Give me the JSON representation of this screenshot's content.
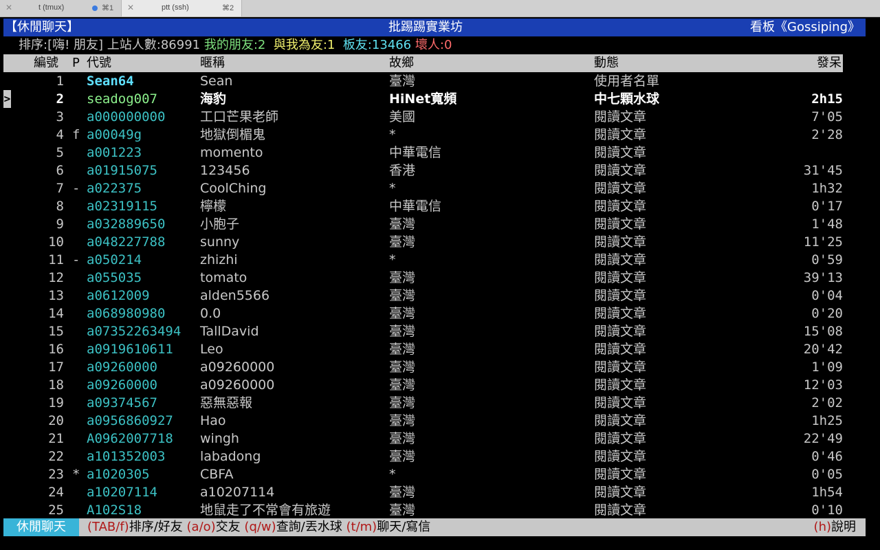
{
  "tabs": [
    {
      "title": "t (tmux)",
      "shortcut": "⌘1",
      "active": false
    },
    {
      "title": "ptt (ssh)",
      "shortcut": "⌘2",
      "active": true
    }
  ],
  "header": {
    "left": "【休閒聊天】",
    "center": "批踢踢實業坊",
    "right": "看板《Gossiping》"
  },
  "status": {
    "sort_label": "排序:[嗨! 朋友]",
    "online_label": "上站人數:86991",
    "my_friends": "我的朋友:2",
    "friend_of": "與我為友:1",
    "board_friends": "板友:13466",
    "bad_people": "壞人:0"
  },
  "columns": {
    "num": "編號",
    "p": "P",
    "id": "代號",
    "nick": "暱稱",
    "from": "故鄉",
    "act": "動態",
    "idle": "發呆"
  },
  "users": [
    {
      "num": "1",
      "p": "",
      "id": "Sean64",
      "nick": "Sean",
      "from": "臺灣",
      "act": "使用者名單",
      "idle": ""
    },
    {
      "num": "2",
      "p": "",
      "id": "seadog007",
      "nick": "海豹",
      "from": "HiNet寬頻",
      "act": "中七顆水球",
      "idle": "2h15"
    },
    {
      "num": "3",
      "p": "",
      "id": "a000000000",
      "nick": "工口芒果老師",
      "from": "美國",
      "act": "閱讀文章",
      "idle": "7'05"
    },
    {
      "num": "4",
      "p": "f",
      "id": "a00049g",
      "nick": "地獄倒楣鬼",
      "from": "*",
      "act": "閱讀文章",
      "idle": "2'28"
    },
    {
      "num": "5",
      "p": "",
      "id": "a001223",
      "nick": "momento",
      "from": "中華電信",
      "act": "閱讀文章",
      "idle": ""
    },
    {
      "num": "6",
      "p": "",
      "id": "a01915075",
      "nick": "123456",
      "from": "香港",
      "act": "閱讀文章",
      "idle": "31'45"
    },
    {
      "num": "7",
      "p": "-",
      "id": "a022375",
      "nick": "CoolChing",
      "from": "*",
      "act": "閱讀文章",
      "idle": "1h32"
    },
    {
      "num": "8",
      "p": "",
      "id": "a02319115",
      "nick": "檸檬",
      "from": "中華電信",
      "act": "閱讀文章",
      "idle": "0'17"
    },
    {
      "num": "9",
      "p": "",
      "id": "a032889650",
      "nick": "小胞子",
      "from": "臺灣",
      "act": "閱讀文章",
      "idle": "1'48"
    },
    {
      "num": "10",
      "p": "",
      "id": "a048227788",
      "nick": "sunny",
      "from": "臺灣",
      "act": "閱讀文章",
      "idle": "11'25"
    },
    {
      "num": "11",
      "p": "-",
      "id": "a050214",
      "nick": "zhizhi",
      "from": "*",
      "act": "閱讀文章",
      "idle": "0'59"
    },
    {
      "num": "12",
      "p": "",
      "id": "a055035",
      "nick": "tomato",
      "from": "臺灣",
      "act": "閱讀文章",
      "idle": "39'13"
    },
    {
      "num": "13",
      "p": "",
      "id": "a0612009",
      "nick": "alden5566",
      "from": "臺灣",
      "act": "閱讀文章",
      "idle": "0'04"
    },
    {
      "num": "14",
      "p": "",
      "id": "a068980980",
      "nick": "0.0",
      "from": "臺灣",
      "act": "閱讀文章",
      "idle": "0'20"
    },
    {
      "num": "15",
      "p": "",
      "id": "a07352263494",
      "nick": "TallDavid",
      "from": "臺灣",
      "act": "閱讀文章",
      "idle": "15'08"
    },
    {
      "num": "16",
      "p": "",
      "id": "a0919610611",
      "nick": "Leo",
      "from": "臺灣",
      "act": "閱讀文章",
      "idle": "20'42"
    },
    {
      "num": "17",
      "p": "",
      "id": "a09260000",
      "nick": "a09260000",
      "from": "臺灣",
      "act": "閱讀文章",
      "idle": "1'09"
    },
    {
      "num": "18",
      "p": "",
      "id": "a09260000",
      "nick": "a09260000",
      "from": "臺灣",
      "act": "閱讀文章",
      "idle": "12'03"
    },
    {
      "num": "19",
      "p": "",
      "id": "a09374567",
      "nick": "惡無惡報",
      "from": "臺灣",
      "act": "閱讀文章",
      "idle": "2'02"
    },
    {
      "num": "20",
      "p": "",
      "id": "a0956860927",
      "nick": "Hao",
      "from": "臺灣",
      "act": "閱讀文章",
      "idle": "1h25"
    },
    {
      "num": "21",
      "p": "",
      "id": "A0962007718",
      "nick": "wingh",
      "from": "臺灣",
      "act": "閱讀文章",
      "idle": "22'49"
    },
    {
      "num": "22",
      "p": "",
      "id": "a101352003",
      "nick": "labadong",
      "from": "臺灣",
      "act": "閱讀文章",
      "idle": "0'46"
    },
    {
      "num": "23",
      "p": "*",
      "id": "a1020305",
      "nick": "CBFA",
      "from": "*",
      "act": "閱讀文章",
      "idle": "0'05"
    },
    {
      "num": "24",
      "p": "",
      "id": "a10207114",
      "nick": "a10207114",
      "from": "臺灣",
      "act": "閱讀文章",
      "idle": "1h54"
    },
    {
      "num": "25",
      "p": "",
      "id": "A102S18",
      "nick": "地鼠走了不常會有旅遊",
      "from": "臺灣",
      "act": "閱讀文章",
      "idle": "0'10"
    }
  ],
  "cursor_glyph": ">",
  "footer": {
    "mode": "休閒聊天",
    "keys": [
      {
        "key": "(TAB/f)",
        "desc": "排序/好友"
      },
      {
        "key": "(a/o)",
        "desc": "交友"
      },
      {
        "key": "(q/w)",
        "desc": "查詢/丟水球"
      },
      {
        "key": "(t/m)",
        "desc": "聊天/寫信"
      }
    ],
    "help_key": "(h)",
    "help_desc": "說明"
  },
  "colors": {
    "header_bg": "#1a3fb3",
    "id_color": "#3cc1c4",
    "mode_bg": "#38b4d8",
    "key_color": "#b01818"
  }
}
